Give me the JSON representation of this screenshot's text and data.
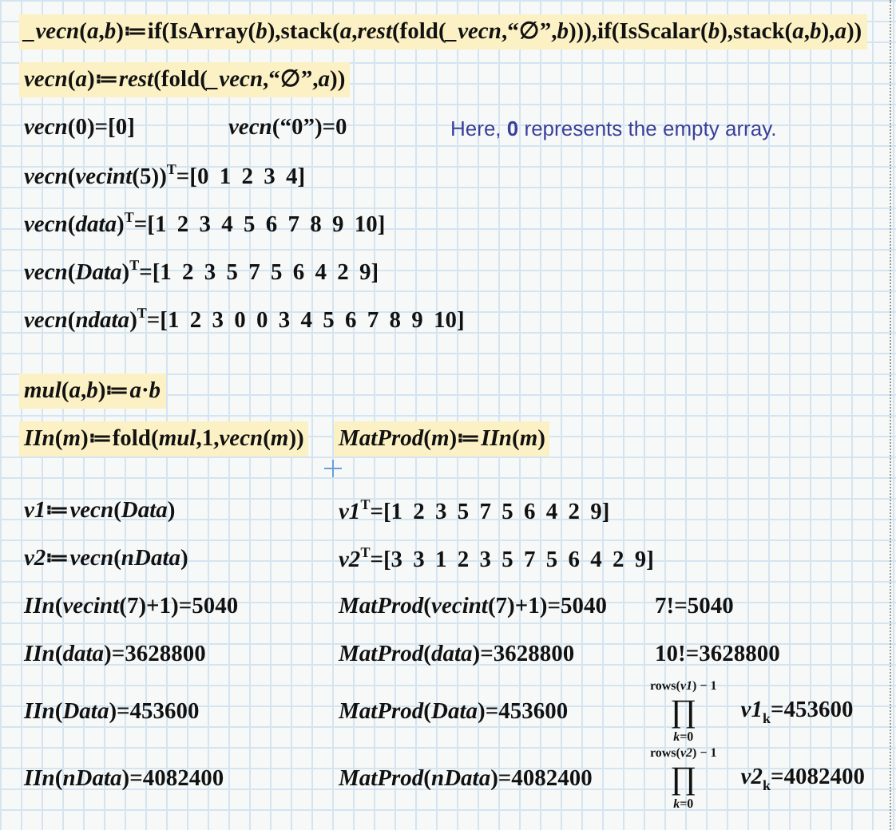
{
  "worksheet": {
    "rows": [
      {
        "cells": [
          {
            "kind": "math",
            "highlighted": true,
            "text": "*_vecn*(*a*,*b*)≔if(IsArray(*b*),stack(*a*,*rest*(fold(*_vecn*,“∅”,*b*))),if(IsScalar(*b*),stack(*a*,*b*),*a*))"
          }
        ]
      },
      {
        "cells": [
          {
            "kind": "math",
            "highlighted": true,
            "text": "*vecn*(*a*)≔*rest*(fold(*_vecn*,“∅”,*a*))"
          }
        ]
      },
      {
        "cells": [
          {
            "kind": "math",
            "highlighted": false,
            "text": "*vecn*(0)=[0]"
          },
          {
            "kind": "math",
            "highlighted": false,
            "text": "*vecn*(“0”)=0"
          },
          {
            "kind": "note",
            "text": "Here, **0** represents the empty array."
          }
        ]
      },
      {
        "cells": [
          {
            "kind": "math",
            "highlighted": false,
            "text": "*vecn*(*vecint*(5))$^{T}$=[0 1 2 3 4]"
          }
        ]
      },
      {
        "cells": [
          {
            "kind": "math",
            "highlighted": false,
            "text": "*vecn*(*data*)$^{T}$=[1 2 3 4 5 6 7 8 9 10]"
          }
        ]
      },
      {
        "cells": [
          {
            "kind": "math",
            "highlighted": false,
            "text": "*vecn*(*Data*)$^{T}$=[1 2 3 5 7 5 6 4 2 9]"
          }
        ]
      },
      {
        "cells": [
          {
            "kind": "math",
            "highlighted": false,
            "text": "*vecn*(*ndata*)$^{T}$=[1 2 3 0 0 3 4 5 6 7 8 9 10]"
          }
        ]
      },
      {
        "cells": [
          {
            "kind": "math",
            "highlighted": true,
            "text": "*mul*(*a*,*b*)≔*a*·*b*"
          }
        ]
      },
      {
        "cells": [
          {
            "kind": "math",
            "highlighted": true,
            "text": "*IIn*(*m*)≔fold(*mul*,1,*vecn*(*m*))"
          },
          {
            "kind": "math",
            "highlighted": true,
            "text": "*MatProd*(*m*)≔*IIn*(*m*)"
          }
        ]
      },
      {
        "cells": [
          {
            "kind": "math",
            "highlighted": false,
            "text": "*v1*≔*vecn*(*Data*)"
          },
          {
            "kind": "math",
            "highlighted": false,
            "text": "*v1*$^{T}$=[1 2 3 5 7 5 6 4 2 9]"
          }
        ]
      },
      {
        "cells": [
          {
            "kind": "math",
            "highlighted": false,
            "text": "*v2*≔*vecn*(*nData*)"
          },
          {
            "kind": "math",
            "highlighted": false,
            "text": "*v2*$^{T}$=[3 3 1 2 3 5 7 5 6 4 2 9]"
          }
        ]
      },
      {
        "cells": [
          {
            "kind": "math",
            "highlighted": false,
            "text": "*IIn*(*vecint*(7)+1)=5040"
          },
          {
            "kind": "math",
            "highlighted": false,
            "text": "*MatProd*(*vecint*(7)+1)=5040"
          },
          {
            "kind": "math",
            "highlighted": false,
            "text": "7!=5040"
          }
        ]
      },
      {
        "cells": [
          {
            "kind": "math",
            "highlighted": false,
            "text": "*IIn*(*data*)=3628800"
          },
          {
            "kind": "math",
            "highlighted": false,
            "text": "*MatProd*(*data*)=3628800"
          },
          {
            "kind": "math",
            "highlighted": false,
            "text": "10!=3628800"
          }
        ]
      },
      {
        "cells": [
          {
            "kind": "math",
            "highlighted": false,
            "text": "*IIn*(*Data*)=453600"
          },
          {
            "kind": "math",
            "highlighted": false,
            "text": "*MatProd*(*Data*)=453600"
          },
          {
            "kind": "product",
            "upper": "rows(*v1*) − 1",
            "symbol": "∏",
            "lower": "*k*=0",
            "text": "*v1*$_{k}$=453600"
          }
        ]
      },
      {
        "cells": [
          {
            "kind": "math",
            "highlighted": false,
            "text": "*IIn*(*nData*)=4082400"
          },
          {
            "kind": "math",
            "highlighted": false,
            "text": "*MatProd*(*nData*)=4082400"
          },
          {
            "kind": "product",
            "upper": "rows(*v2*) − 1",
            "symbol": "∏",
            "lower": "*k*=0",
            "text": "*v2*$_{k}$=4082400"
          }
        ]
      }
    ]
  }
}
